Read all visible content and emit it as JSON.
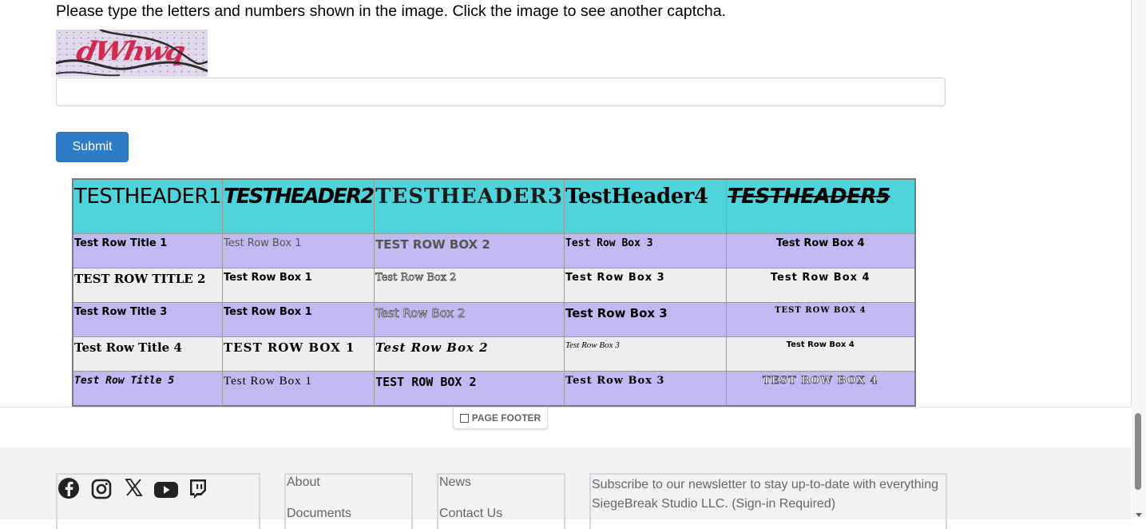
{
  "captcha": {
    "prompt": "Please type the letters and numbers shown in the image. Click the image to see another captcha.",
    "image_text": "dWhwq",
    "input_value": "",
    "submit_label": "Submit"
  },
  "table": {
    "headers": [
      "TESTHEADER1",
      "TESTHEADER2",
      "TESTHEADER3",
      "TestHeader4",
      "TESTHEADER5"
    ],
    "rows": [
      [
        "Test Row Title 1",
        "Test Row Box 1",
        "TEST ROW BOX 2",
        "Test Row Box 3",
        "Test Row Box 4"
      ],
      [
        "TEST ROW TITLE 2",
        "Test Row Box 1",
        "Test Row Box 2",
        "Test Row Box 3",
        "Test Row Box 4"
      ],
      [
        "Test Row Title 3",
        "Test Row Box 1",
        "Test Row Box 2",
        "Test Row Box 3",
        "TEST ROW BOX 4"
      ],
      [
        "Test Row Title 4",
        "TEST ROW BOX 1",
        "Test Row Box 2",
        "Test Row Box 3",
        "Test Row Box 4"
      ],
      [
        "Test Row Title 5",
        "Test Row Box 1",
        "TEST ROW BOX 2",
        "Test Row Box 3",
        "TEST ROW BOX 4"
      ]
    ]
  },
  "page_footer_tag": "PAGE FOOTER",
  "footer": {
    "social_icons": [
      "facebook-icon",
      "instagram-icon",
      "x-icon",
      "youtube-icon",
      "twitch-icon"
    ],
    "col2_links": [
      "About",
      "Documents"
    ],
    "col3_links": [
      "News",
      "Contact Us"
    ],
    "newsletter_text": "Subscribe to our newsletter to stay up-to-date with everything SiegeBreak Studio LLC. (Sign-in Required)"
  },
  "colors": {
    "header_bg": "#4fd4dc",
    "odd_row_bg": "#c3b8f1",
    "even_row_bg": "#eceeef",
    "submit_bg": "#2f7bc8",
    "captcha_text": "#cf2a50"
  }
}
